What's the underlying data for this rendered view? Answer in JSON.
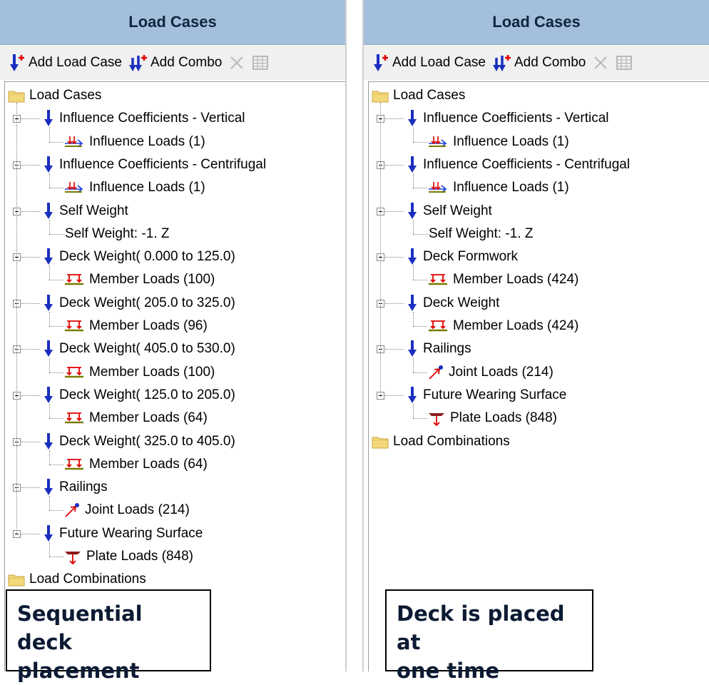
{
  "left": {
    "title": "Load Cases",
    "toolbar": {
      "add_load_case": "Add Load Case",
      "add_combo": "Add Combo"
    },
    "tree": [
      {
        "label": "Load Cases",
        "icon": "folder-icon",
        "level": 0
      },
      {
        "label": "Influence Coefficients - Vertical",
        "icon": "load-case-icon",
        "level": 1
      },
      {
        "label": "Influence Loads (1)",
        "icon": "influence-load-icon",
        "level": 2
      },
      {
        "label": "Influence Coefficients - Centrifugal",
        "icon": "load-case-icon",
        "level": 1
      },
      {
        "label": "Influence Loads (1)",
        "icon": "influence-load-icon",
        "level": 2
      },
      {
        "label": "Self Weight",
        "icon": "load-case-icon",
        "level": 1
      },
      {
        "label": "Self Weight: -1. Z",
        "icon": "",
        "level": 2
      },
      {
        "label": "Deck Weight( 0.000 to  125.0)",
        "icon": "load-case-icon",
        "level": 1
      },
      {
        "label": "Member Loads (100)",
        "icon": "member-load-icon",
        "level": 2
      },
      {
        "label": "Deck Weight( 205.0 to  325.0)",
        "icon": "load-case-icon",
        "level": 1
      },
      {
        "label": "Member Loads (96)",
        "icon": "member-load-icon",
        "level": 2
      },
      {
        "label": "Deck Weight( 405.0 to  530.0)",
        "icon": "load-case-icon",
        "level": 1
      },
      {
        "label": "Member Loads (100)",
        "icon": "member-load-icon",
        "level": 2
      },
      {
        "label": "Deck Weight( 125.0 to  205.0)",
        "icon": "load-case-icon",
        "level": 1
      },
      {
        "label": "Member Loads (64)",
        "icon": "member-load-icon",
        "level": 2
      },
      {
        "label": "Deck Weight( 325.0 to  405.0)",
        "icon": "load-case-icon",
        "level": 1
      },
      {
        "label": "Member Loads (64)",
        "icon": "member-load-icon",
        "level": 2
      },
      {
        "label": "Railings",
        "icon": "load-case-icon",
        "level": 1
      },
      {
        "label": "Joint Loads (214)",
        "icon": "joint-load-icon",
        "level": 2
      },
      {
        "label": "Future Wearing Surface",
        "icon": "load-case-icon",
        "level": 1
      },
      {
        "label": "Plate Loads (848)",
        "icon": "plate-load-icon",
        "level": 2
      },
      {
        "label": "Load Combinations",
        "icon": "folder-icon",
        "level": 0
      }
    ],
    "note_line1": "Sequential deck",
    "note_line2": "placement"
  },
  "right": {
    "title": "Load Cases",
    "toolbar": {
      "add_load_case": "Add Load Case",
      "add_combo": "Add Combo"
    },
    "tree": [
      {
        "label": "Load Cases",
        "icon": "folder-icon",
        "level": 0
      },
      {
        "label": "Influence Coefficients - Vertical",
        "icon": "load-case-icon",
        "level": 1
      },
      {
        "label": "Influence Loads (1)",
        "icon": "influence-load-icon",
        "level": 2
      },
      {
        "label": "Influence Coefficients - Centrifugal",
        "icon": "load-case-icon",
        "level": 1
      },
      {
        "label": "Influence Loads (1)",
        "icon": "influence-load-icon",
        "level": 2
      },
      {
        "label": "Self Weight",
        "icon": "load-case-icon",
        "level": 1
      },
      {
        "label": "Self Weight: -1. Z",
        "icon": "",
        "level": 2
      },
      {
        "label": "Deck Formwork",
        "icon": "load-case-icon",
        "level": 1
      },
      {
        "label": "Member Loads (424)",
        "icon": "member-load-icon",
        "level": 2
      },
      {
        "label": "Deck Weight",
        "icon": "load-case-icon",
        "level": 1
      },
      {
        "label": "Member Loads (424)",
        "icon": "member-load-icon",
        "level": 2
      },
      {
        "label": "Railings",
        "icon": "load-case-icon",
        "level": 1
      },
      {
        "label": "Joint Loads (214)",
        "icon": "joint-load-icon",
        "level": 2
      },
      {
        "label": "Future Wearing Surface",
        "icon": "load-case-icon",
        "level": 1
      },
      {
        "label": "Plate Loads (848)",
        "icon": "plate-load-icon",
        "level": 2
      },
      {
        "label": "Load Combinations",
        "icon": "folder-icon",
        "level": 0
      }
    ],
    "note_line1": "Deck is placed at",
    "note_line2": "one time"
  }
}
